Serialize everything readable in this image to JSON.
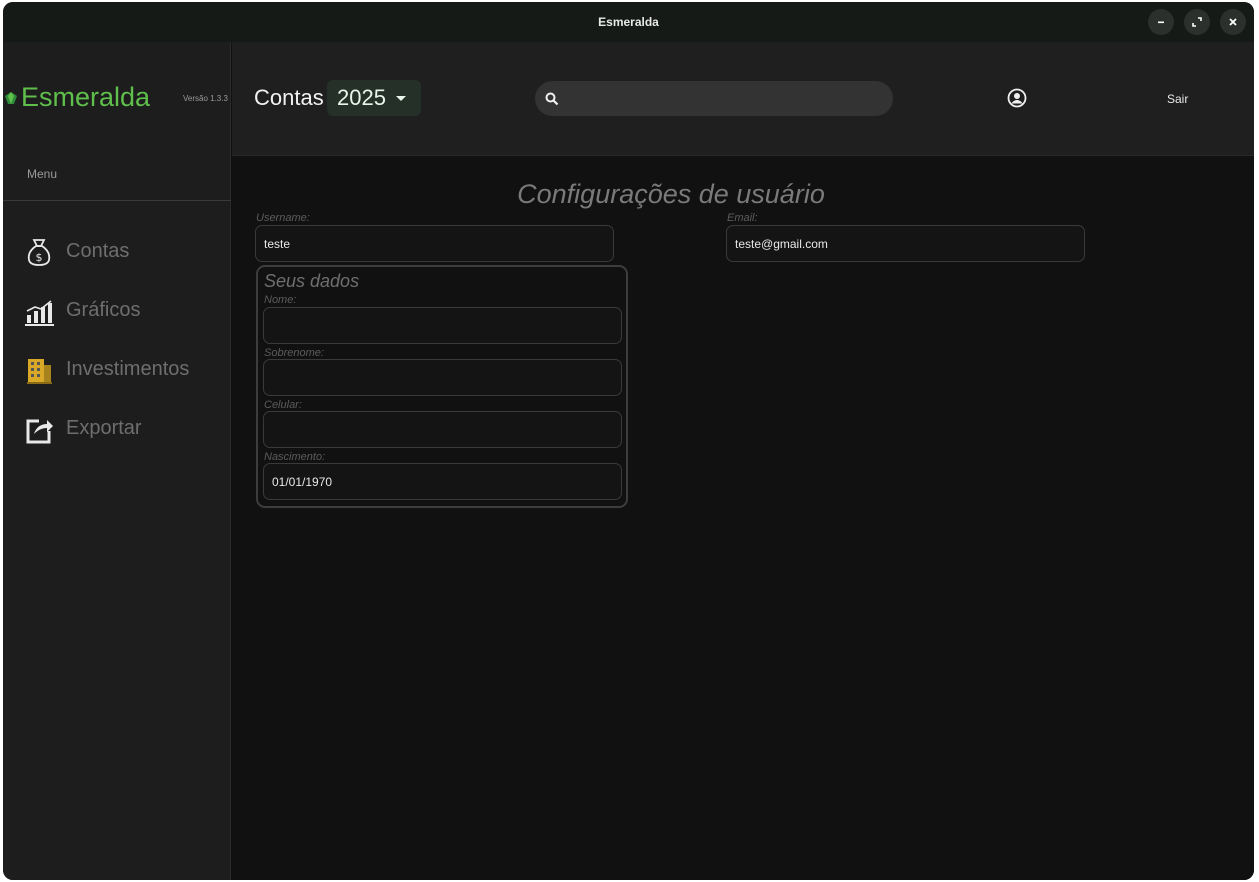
{
  "window": {
    "title": "Esmeralda"
  },
  "sidebar": {
    "brand": "Esmeralda",
    "version": "Versão 1.3.3",
    "menu_label": "Menu",
    "items": [
      {
        "label": "Contas",
        "icon": "money-bag-icon"
      },
      {
        "label": "Gráficos",
        "icon": "bar-chart-icon"
      },
      {
        "label": "Investimentos",
        "icon": "building-icon"
      },
      {
        "label": "Exportar",
        "icon": "export-icon"
      }
    ]
  },
  "header": {
    "title": "Contas",
    "year": "2025",
    "search_placeholder": "",
    "logout_label": "Sair"
  },
  "page": {
    "title": "Configurações de usuário",
    "username": {
      "label": "Username:",
      "value": "teste"
    },
    "email": {
      "label": "Email:",
      "value": "teste@gmail.com"
    },
    "personal": {
      "title": "Seus dados",
      "nome": {
        "label": "Nome:",
        "value": ""
      },
      "sobrenome": {
        "label": "Sobrenome:",
        "value": ""
      },
      "celular": {
        "label": "Celular:",
        "value": ""
      },
      "nascimento": {
        "label": "Nascimento:",
        "value": "01/01/1970"
      }
    }
  },
  "colors": {
    "brand_green": "#5fbf4b",
    "background": "#111111",
    "sidebar": "#1d1d1d"
  }
}
